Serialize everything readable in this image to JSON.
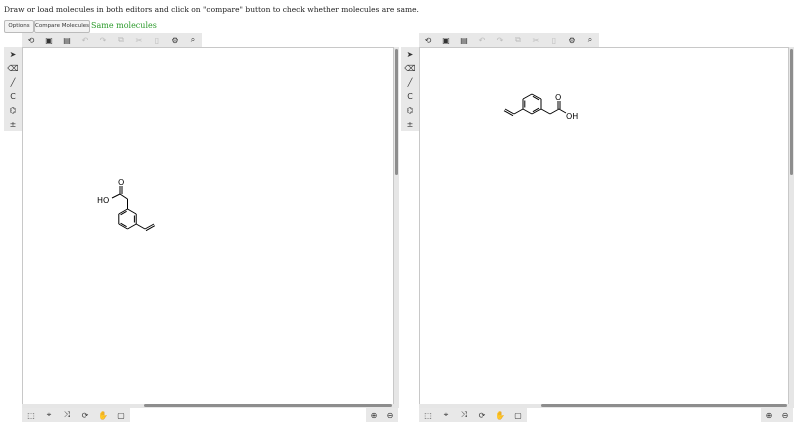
{
  "instructions": "Draw or load molecules in both editors and click on \"compare\" button to check whether molecules are same.",
  "buttons": {
    "options": "Options",
    "compare": "Compare Molecules"
  },
  "status": {
    "text": "Same molecules",
    "color": "#2a9a2a"
  },
  "toolbar_top_icons": [
    "new-document-icon",
    "open-icon",
    "save-icon",
    "undo-icon",
    "redo-icon",
    "copy-icon",
    "cut-icon",
    "paste-icon",
    "settings-icon",
    "search-icon"
  ],
  "toolbar_left_icons": [
    "select-arrow-icon",
    "eraser-icon",
    "bond-icon",
    "chain-icon",
    "ring-icon",
    "charge-icon"
  ],
  "toolbar_bottom_icons": [
    "select-tool-icon",
    "lasso-icon",
    "fragment-icon",
    "rotate-icon",
    "hand-icon",
    "frame-icon"
  ],
  "zoom_icons": [
    "zoom-in-icon",
    "zoom-out-icon"
  ],
  "editors": [
    {
      "molecule": {
        "atom_labels": {
          "oxygen": "O",
          "hydroxyl": "HO"
        }
      }
    },
    {
      "molecule": {
        "atom_labels": {
          "oxygen": "O",
          "hydroxyl": "OH"
        }
      }
    }
  ]
}
